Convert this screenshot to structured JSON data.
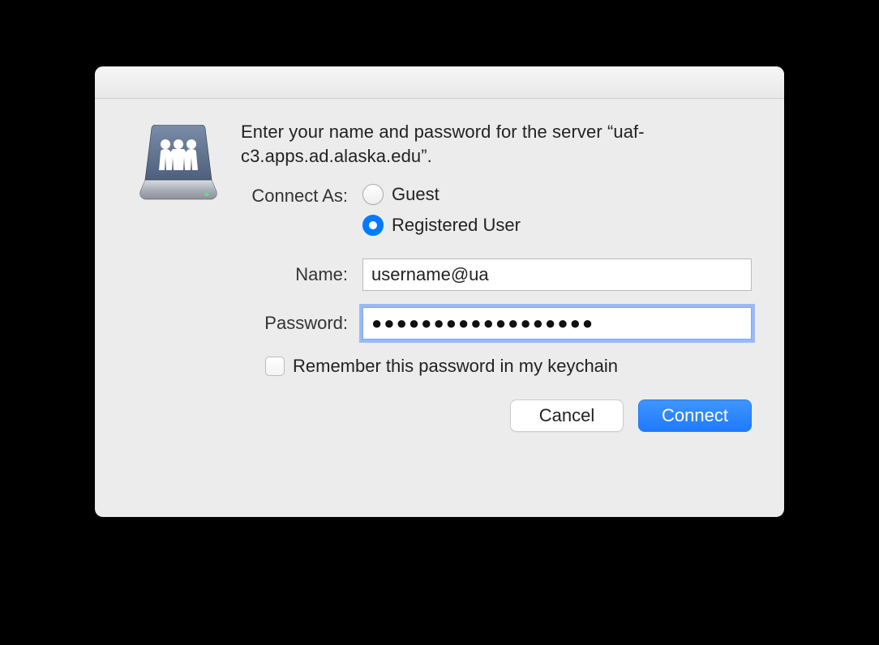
{
  "prompt": "Enter your name and password for the server “uaf-c3.apps.ad.alaska.edu”.",
  "connectAs": {
    "label": "Connect As:",
    "guest": "Guest",
    "registered": "Registered User",
    "selected": "registered"
  },
  "nameField": {
    "label": "Name:",
    "value": "username@ua"
  },
  "passwordField": {
    "label": "Password:",
    "value": "●●●●●●●●●●●●●●●●●●"
  },
  "remember": {
    "label": "Remember this password in my keychain",
    "checked": false
  },
  "buttons": {
    "cancel": "Cancel",
    "connect": "Connect"
  }
}
